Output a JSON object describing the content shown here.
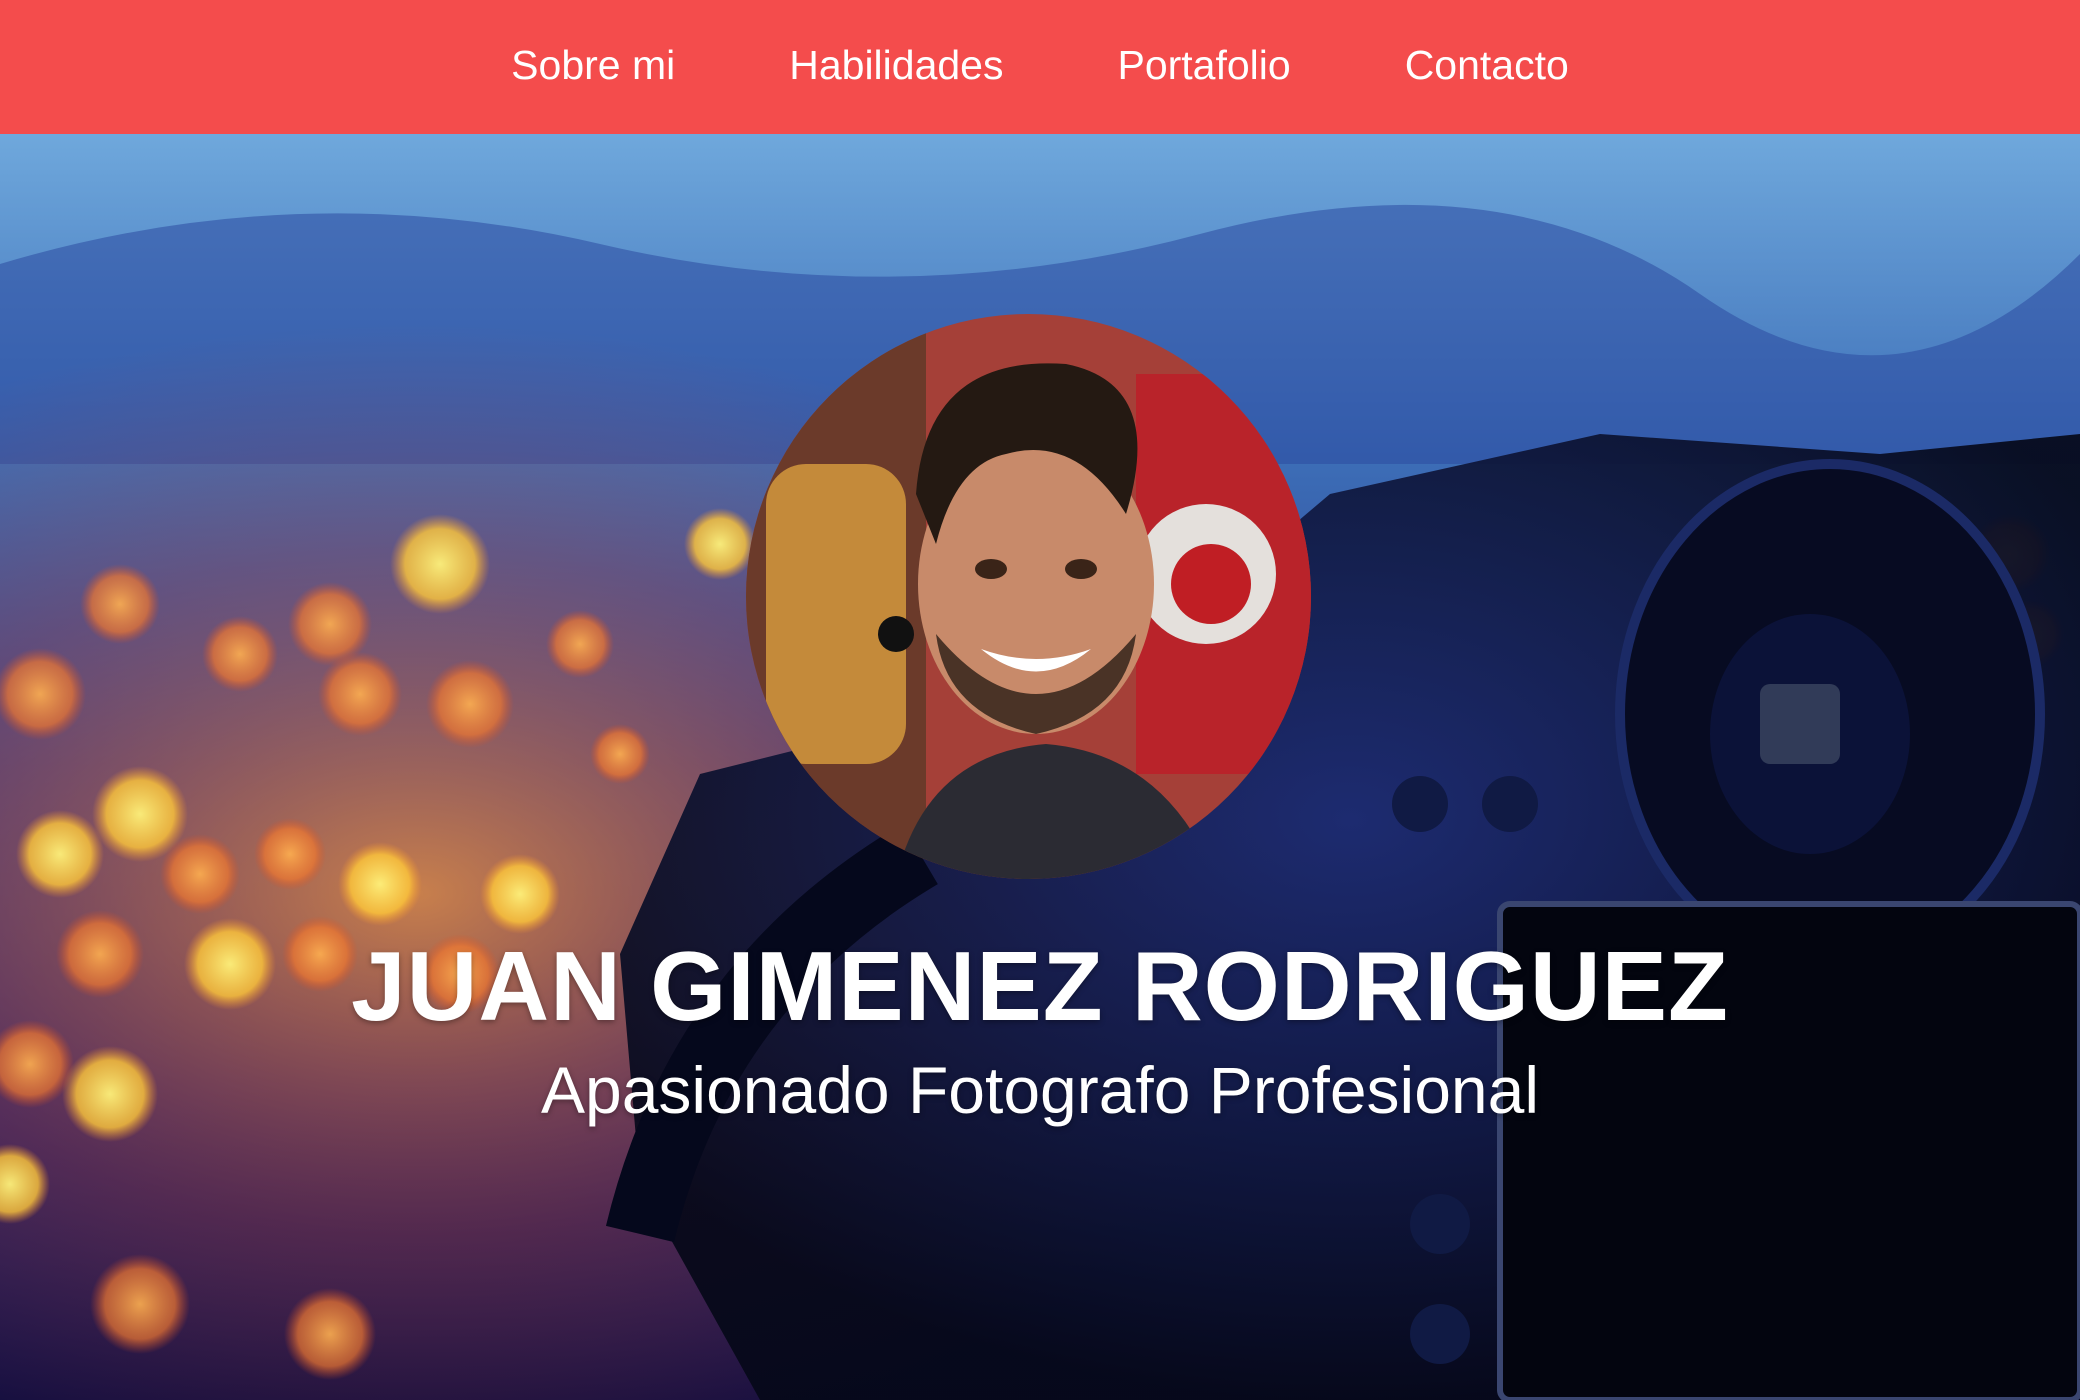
{
  "nav": {
    "items": [
      {
        "label": "Sobre mi"
      },
      {
        "label": "Habilidades"
      },
      {
        "label": "Portafolio"
      },
      {
        "label": "Contacto"
      }
    ]
  },
  "hero": {
    "name": "JUAN GIMENEZ RODRIGUEZ",
    "tagline": "Apasionado Fotografo Profesional"
  },
  "colors": {
    "nav_background": "#f44c4c",
    "text": "#ffffff"
  }
}
